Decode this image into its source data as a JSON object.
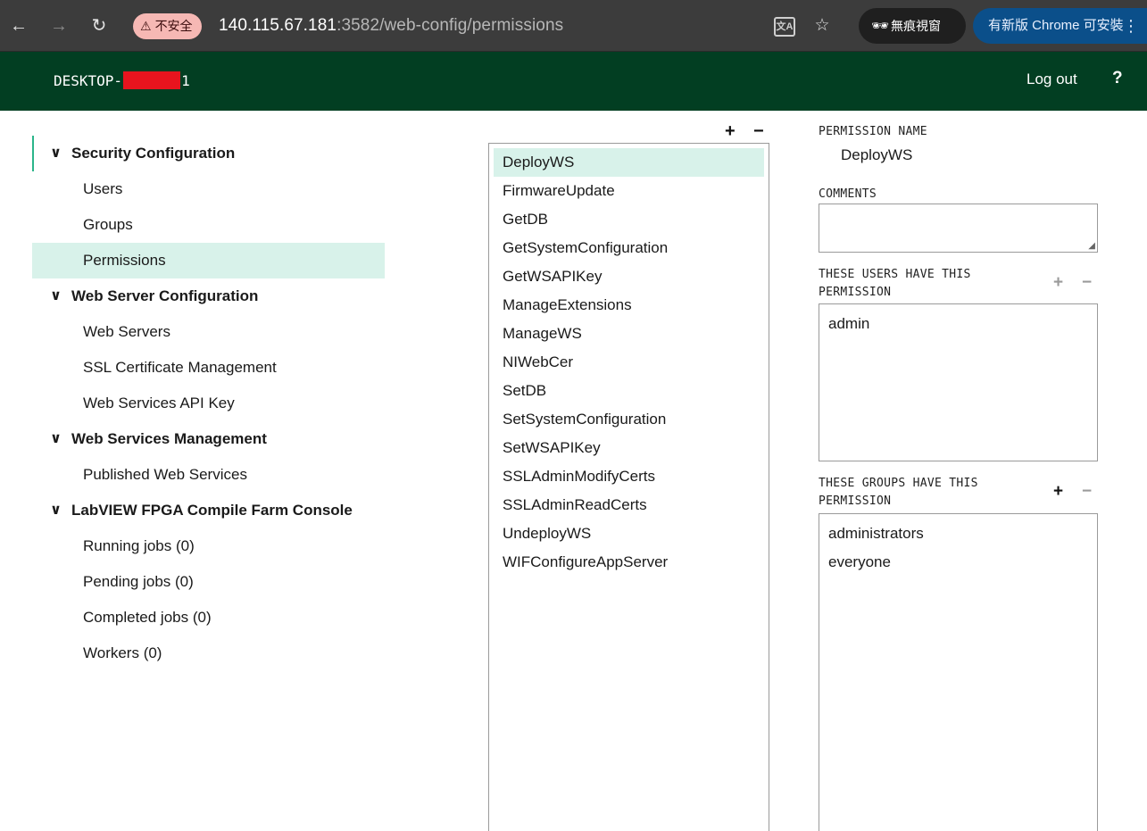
{
  "browser": {
    "back_glyph": "←",
    "forward_glyph": "→",
    "reload_glyph": "↻",
    "security_label": "不安全",
    "url_host": "140.115.67.181",
    "url_rest": ":3582/web-config/permissions",
    "translate_glyph": "文A",
    "bookmark_glyph": "☆",
    "incognito_label": "無痕視窗",
    "update_label": "有新版 Chrome 可安裝",
    "menu_glyph": "⋮"
  },
  "header": {
    "host_prefix": "DESKTOP-",
    "host_suffix": "1",
    "logout_label": "Log out",
    "help_label": "?"
  },
  "sidebar": {
    "sections": [
      {
        "label": "Security Configuration",
        "items": [
          "Users",
          "Groups",
          "Permissions"
        ]
      },
      {
        "label": "Web Server Configuration",
        "items": [
          "Web Servers",
          "SSL Certificate Management",
          "Web Services API Key"
        ]
      },
      {
        "label": "Web Services Management",
        "items": [
          "Published Web Services"
        ]
      },
      {
        "label": "LabVIEW FPGA Compile Farm Console",
        "items": [
          "Running jobs (0)",
          "Pending jobs (0)",
          "Completed jobs (0)",
          "Workers (0)"
        ]
      }
    ],
    "selected_item": "Permissions"
  },
  "permissions": {
    "add_glyph": "+",
    "remove_glyph": "−",
    "items": [
      "DeployWS",
      "FirmwareUpdate",
      "GetDB",
      "GetSystemConfiguration",
      "GetWSAPIKey",
      "ManageExtensions",
      "ManageWS",
      "NIWebCer",
      "SetDB",
      "SetSystemConfiguration",
      "SetWSAPIKey",
      "SSLAdminModifyCerts",
      "SSLAdminReadCerts",
      "UndeployWS",
      "WIFConfigureAppServer"
    ],
    "selected": "DeployWS"
  },
  "details": {
    "name_label": "PERMISSION NAME",
    "name_value": "DeployWS",
    "comments_label": "COMMENTS",
    "comments_value": "",
    "users_label_line1": "THESE USERS HAVE THIS",
    "users_label_line2": "PERMISSION",
    "users": [
      "admin"
    ],
    "groups_label_line1": "THESE GROUPS HAVE THIS",
    "groups_label_line2": "PERMISSION",
    "groups": [
      "administrators",
      "everyone"
    ]
  },
  "colors": {
    "header_bg": "#023e22",
    "selected_bg": "#d8f2ea",
    "active_accent": "#2bb58a",
    "redaction": "#e8141e"
  }
}
